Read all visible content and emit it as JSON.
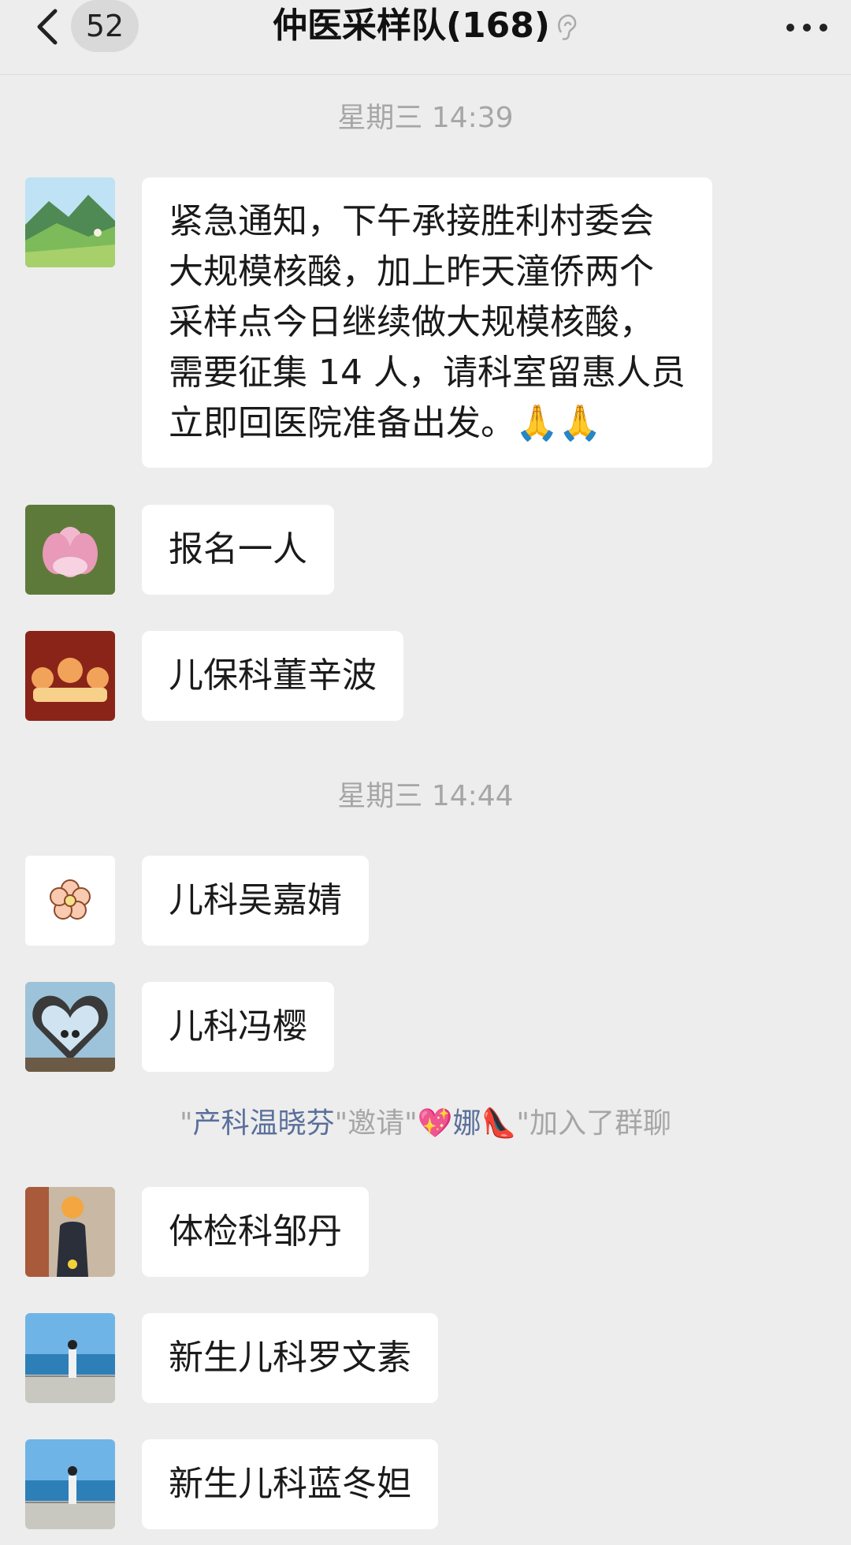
{
  "header": {
    "back_count": "52",
    "title": "仲医采样队(168)",
    "back_icon": "chevron-left-icon",
    "mute_icon": "mute-ear-icon",
    "more_icon": "more-dots-icon"
  },
  "timestamps": [
    "星期三 14:39",
    "星期三 14:44"
  ],
  "messages": [
    {
      "avatar_icon": "mountain-landscape-avatar",
      "lines": [
        "紧急通知，下午承接胜利村委会",
        "大规模核酸，加上昨天潼侨两个",
        "采样点今日继续做大规模核酸，",
        "需要征集 14 人，请科室留惠人员",
        "立即回医院准备出发。🙏🙏"
      ]
    },
    {
      "avatar_icon": "magnolia-flower-avatar",
      "text": "报名一人"
    },
    {
      "avatar_icon": "tiger-cartoon-avatar",
      "text": "儿保科董辛波"
    },
    {
      "avatar_icon": "flower-icon-avatar",
      "text": "儿科吴嘉婧"
    },
    {
      "avatar_icon": "heart-arch-photo-avatar",
      "text": "儿科冯樱"
    },
    {
      "avatar_icon": "woman-photo-avatar",
      "text": "体检科邹丹"
    },
    {
      "avatar_icon": "seaside-photo-avatar",
      "text": "新生儿科罗文素"
    },
    {
      "avatar_icon": "seaside-photo-avatar-2",
      "text": "新生儿科蓝冬妲"
    }
  ],
  "system_note": {
    "open_quote": "\"",
    "inviter": "产科温晓芬",
    "mid": "\"邀请\"",
    "invitee_heart": "💖",
    "invitee": "娜",
    "invitee_shoe": "👠",
    "tail": "\"加入了群聊"
  },
  "colors": {
    "background": "#ededed",
    "bubble": "#ffffff",
    "timestamp_text": "#a6a6a6",
    "system_link": "#5a6f9a"
  }
}
